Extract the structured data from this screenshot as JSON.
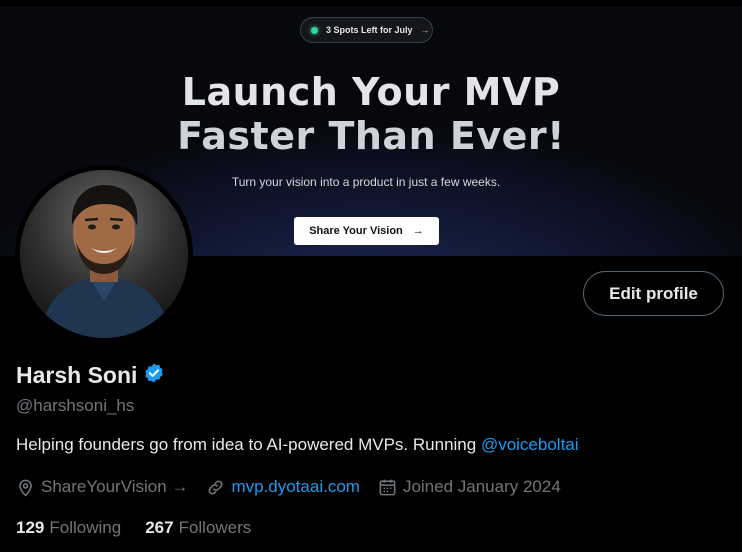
{
  "banner": {
    "pill_text": "3 Spots Left for July",
    "pill_arrow": "→",
    "headline_line1": "Launch Your MVP",
    "headline_line2": "Faster Than Ever!",
    "subline": "Turn your vision into a product in just a few weeks.",
    "cta_label": "Share Your Vision",
    "cta_arrow": "→"
  },
  "profile": {
    "edit_button_label": "Edit profile",
    "name": "Harsh Soni",
    "handle": "@harshsoni_hs",
    "bio_text": "Helping founders go from idea to AI-powered MVPs. Running ",
    "bio_mention": "@voiceboltai",
    "location": "ShareYourVision →",
    "website": "mvp.dyotaai.com",
    "joined": "Joined January 2024",
    "following_count": "129",
    "following_label": "Following",
    "followers_count": "267",
    "followers_label": "Followers"
  },
  "colors": {
    "accent": "#1d9bf0",
    "muted": "#71767b",
    "text": "#e7e9ea",
    "verified": "#1d9bf0"
  },
  "icons": [
    "location-pin-icon",
    "link-icon",
    "calendar-icon",
    "verified-badge-icon",
    "arrow-right-icon"
  ]
}
